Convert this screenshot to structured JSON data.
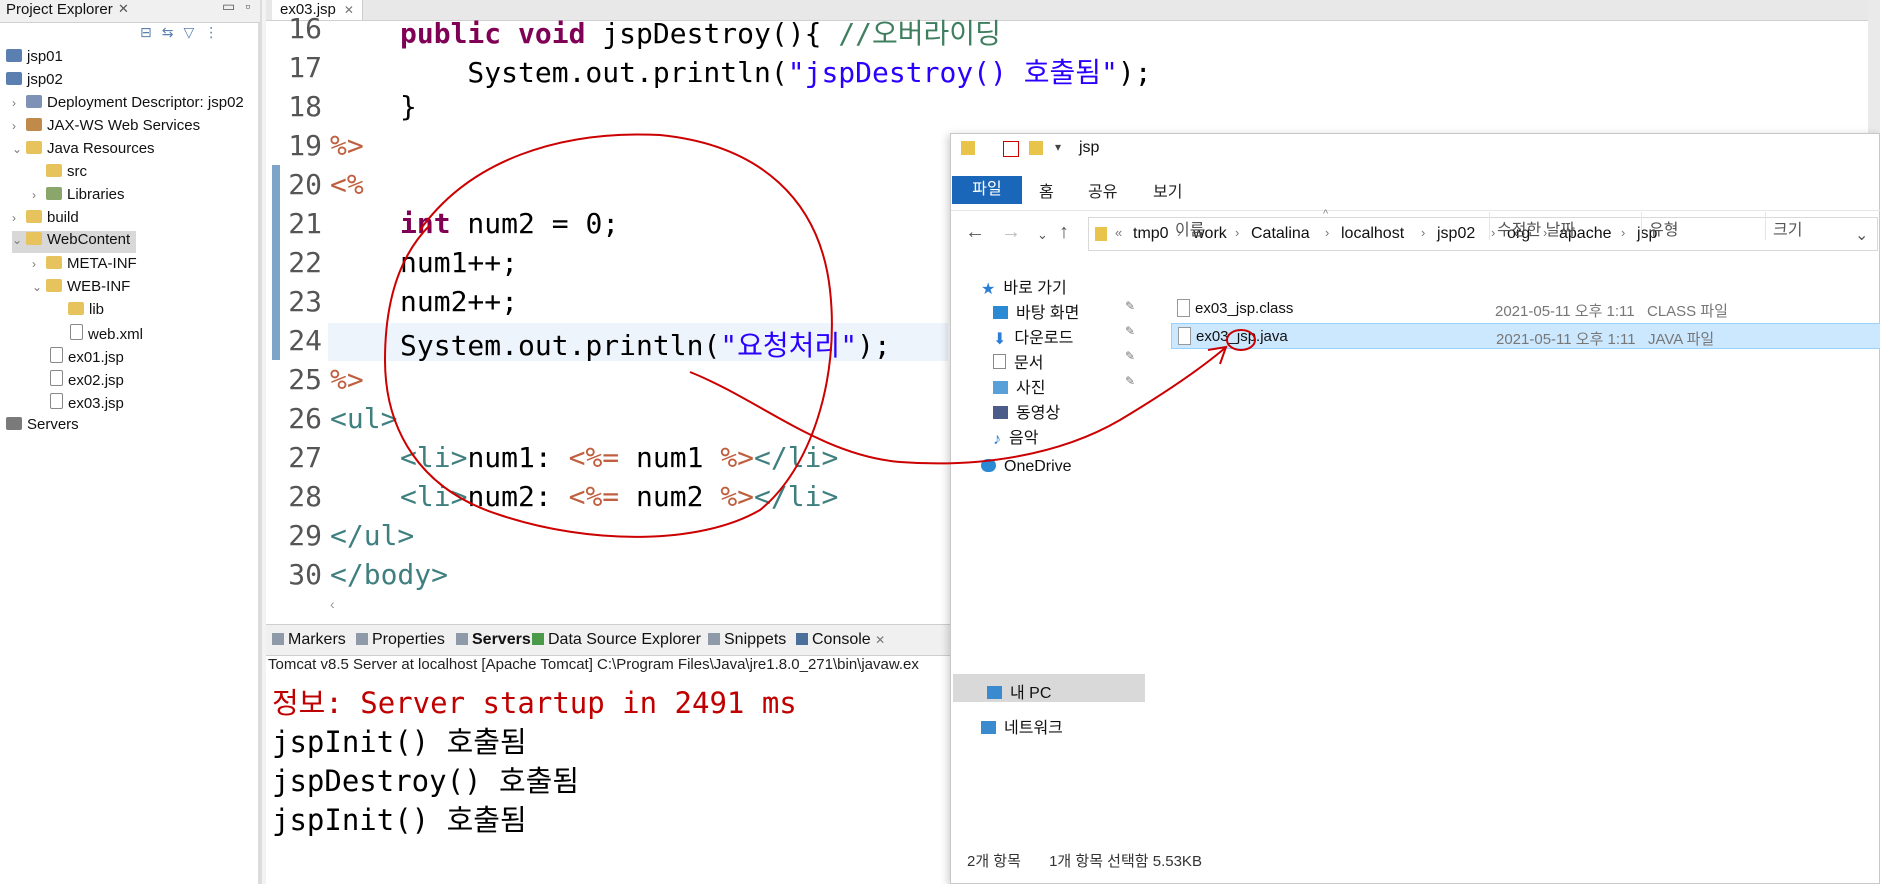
{
  "project_explorer": {
    "tab_label": "Project Explorer",
    "tab_close": "✕",
    "items": [
      {
        "label": "jsp01",
        "arrow": "",
        "icon": "project-icon"
      },
      {
        "label": "jsp02",
        "arrow": "",
        "icon": "project-icon"
      },
      {
        "label": "Deployment Descriptor: jsp02",
        "arrow": "›",
        "icon": "deployment-descriptor-icon"
      },
      {
        "label": "JAX-WS Web Services",
        "arrow": "›",
        "icon": "web-services-icon"
      },
      {
        "label": "Java Resources",
        "arrow": "⌄",
        "icon": "java-resources-icon"
      },
      {
        "label": "src",
        "arrow": "",
        "icon": "package-folder-icon"
      },
      {
        "label": "Libraries",
        "arrow": "›",
        "icon": "libraries-icon"
      },
      {
        "label": "build",
        "arrow": "›",
        "icon": "folder-icon"
      },
      {
        "label": "WebContent",
        "arrow": "⌄",
        "icon": "folder-open-icon"
      },
      {
        "label": "META-INF",
        "arrow": "›",
        "icon": "folder-icon"
      },
      {
        "label": "WEB-INF",
        "arrow": "⌄",
        "icon": "folder-open-icon"
      },
      {
        "label": "lib",
        "arrow": "",
        "icon": "folder-icon"
      },
      {
        "label": "web.xml",
        "arrow": "",
        "icon": "xml-file-icon"
      },
      {
        "label": "ex01.jsp",
        "arrow": "",
        "icon": "jsp-file-icon"
      },
      {
        "label": "ex02.jsp",
        "arrow": "",
        "icon": "jsp-file-icon"
      },
      {
        "label": "ex03.jsp",
        "arrow": "",
        "icon": "jsp-file-icon"
      },
      {
        "label": "Servers",
        "arrow": "",
        "icon": "servers-folder-icon"
      }
    ]
  },
  "editor": {
    "tab_label": "ex03.jsp",
    "tab_close": "✕",
    "line_numbers": [
      "16",
      "17",
      "18",
      "19",
      "20",
      "21",
      "22",
      "23",
      "24",
      "25",
      "26",
      "27",
      "28",
      "29",
      "30"
    ],
    "lines": {
      "l16_kw": "public void",
      "l16_rest": " jspDestroy(){ ",
      "l16_cmt": "//오버라이딩",
      "l17_a": "    System.out.println(",
      "l17_str": "\"jspDestroy() 호출됨\"",
      "l17_b": ");",
      "l18": "}",
      "l19": "%>",
      "l20": "<%",
      "l21_kw": "int",
      "l21_rest": " num2 = 0;",
      "l22": "num1++;",
      "l23": "num2++;",
      "l24_a": "System.out.println(",
      "l24_str": "\"요청처리\"",
      "l24_b": ");",
      "l25": "%>",
      "l26": "<ul>",
      "l27_a": "<li>",
      "l27_b": "num1: ",
      "l27_c": "<%=",
      "l27_d": " num1 ",
      "l27_e": "%>",
      "l27_f": "</li>",
      "l28_a": "<li>",
      "l28_b": "num2: ",
      "l28_c": "<%=",
      "l28_d": " num2 ",
      "l28_e": "%>",
      "l28_f": "</li>",
      "l29": "</ul>",
      "l30": "</body>"
    }
  },
  "console_panel": {
    "tabs": [
      "Markers",
      "Properties",
      "Servers",
      "Data Source Explorer",
      "Snippets",
      "Console"
    ],
    "console_close": "✕",
    "status": "Tomcat v8.5 Server at localhost [Apache Tomcat] C:\\Program Files\\Java\\jre1.8.0_271\\bin\\javaw.ex",
    "output": [
      "정보: Server startup in 2491 ms",
      "jspInit() 호출됨",
      "jspDestroy() 호출됨",
      "jspInit() 호출됨"
    ]
  },
  "file_explorer": {
    "title": "jsp",
    "ribbon_tabs": [
      "파일",
      "홈",
      "공유",
      "보기"
    ],
    "breadcrumb": [
      "tmp0",
      "work",
      "Catalina",
      "localhost",
      "jsp02",
      "org",
      "apache",
      "jsp"
    ],
    "breadcrumb_prefix": "«",
    "nav_items": [
      {
        "label": "바로 가기",
        "icon": "star-icon",
        "pinned": false
      },
      {
        "label": "바탕 화면",
        "icon": "desktop-icon",
        "pinned": true
      },
      {
        "label": "다운로드",
        "icon": "download-icon",
        "pinned": true
      },
      {
        "label": "문서",
        "icon": "documents-icon",
        "pinned": true
      },
      {
        "label": "사진",
        "icon": "pictures-icon",
        "pinned": true
      },
      {
        "label": "동영상",
        "icon": "videos-icon",
        "pinned": false
      },
      {
        "label": "음악",
        "icon": "music-icon",
        "pinned": false
      },
      {
        "label": "OneDrive",
        "icon": "cloud-icon",
        "pinned": false
      },
      {
        "label": "내 PC",
        "icon": "pc-icon",
        "pinned": false
      },
      {
        "label": "네트워크",
        "icon": "network-icon",
        "pinned": false
      }
    ],
    "columns": [
      "이름",
      "수정한 날짜",
      "유형",
      "크기"
    ],
    "files": [
      {
        "name": "ex03_jsp.class",
        "date": "2021-05-11 오후 1:11",
        "type": "CLASS 파일"
      },
      {
        "name": "ex03_jsp.java",
        "date": "2021-05-11 오후 1:11",
        "type": "JAVA 파일"
      }
    ],
    "status_count": "2개 항목",
    "status_selected": "1개 항목 선택함 5.53KB"
  },
  "colors": {
    "keyword": "#7f0055",
    "string": "#2a00ff",
    "jsp_delim": "#bf5f3f",
    "html_tag": "#3f7f7f",
    "console_error": "#c00000",
    "annotation_pen": "#cc0000",
    "ribbon_file_tab": "#1a66b8"
  }
}
